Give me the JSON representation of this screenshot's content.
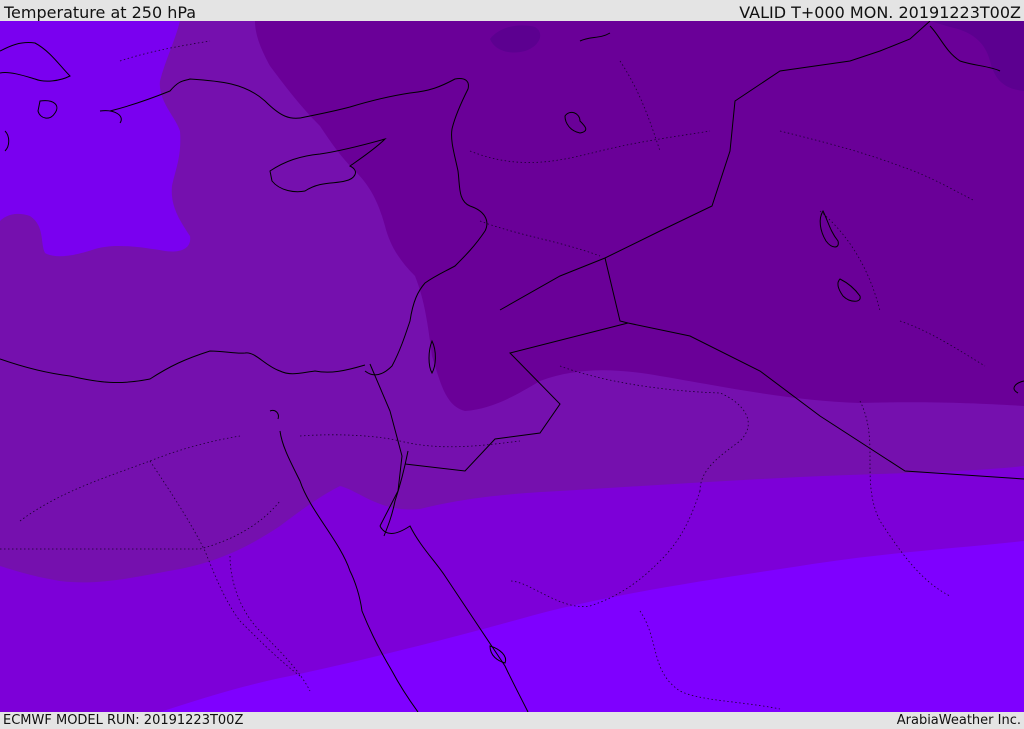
{
  "header": {
    "title": "Temperature at 250 hPa",
    "valid_time": "VALID T+000 MON. 20191223T00Z"
  },
  "footer": {
    "model_run": "ECMWF MODEL RUN: 20191223T00Z",
    "provider": "ArabiaWeather Inc."
  },
  "colors": {
    "band_coldest": "#5c0090",
    "band_cold": "#6a0098",
    "band_mid": "#7510ae",
    "band_warm": "#7d00d8",
    "band_warmest": "#7f00ff",
    "band_nw_pocket": "#7a00f0",
    "coastline": "#000000",
    "border": "#1a0030"
  }
}
